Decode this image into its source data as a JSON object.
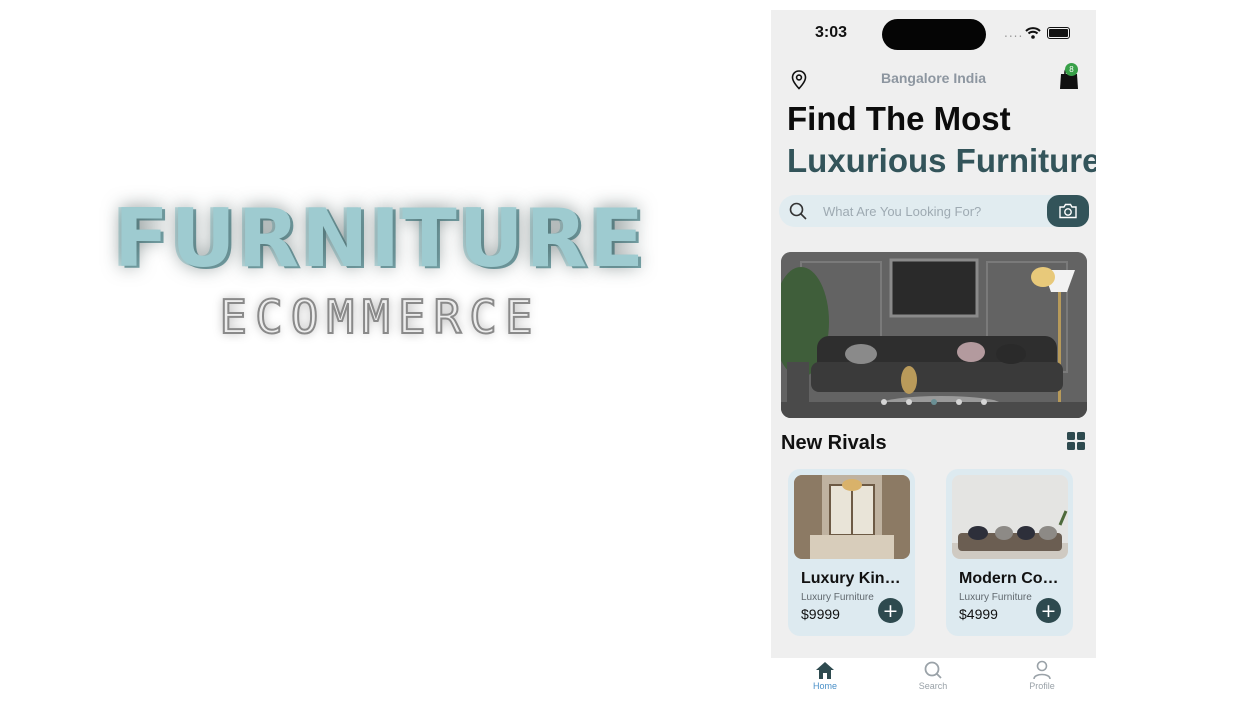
{
  "logo": {
    "title": "FURNITURE",
    "subtitle": "ECOMMERCE"
  },
  "status_bar": {
    "time": "3:03",
    "signal_dots": "...."
  },
  "header": {
    "location": "Bangalore India",
    "cart_badge": "8"
  },
  "hero": {
    "line1": "Find The Most",
    "line2": "Luxurious Furniture"
  },
  "search": {
    "placeholder": "What Are You Looking For?"
  },
  "banner": {
    "slide_count": 5,
    "active_index": 2
  },
  "section": {
    "title": "New Rivals"
  },
  "products": [
    {
      "name": "Luxury King Bed",
      "category": "Luxury Furniture",
      "price": "$9999"
    },
    {
      "name": "Modern Couch",
      "category": "Luxury Furniture",
      "price": "$4999"
    }
  ],
  "tabs": [
    {
      "label": "Home",
      "active": true
    },
    {
      "label": "Search",
      "active": false
    },
    {
      "label": "Profile",
      "active": false
    }
  ],
  "colors": {
    "accent": "#33545a",
    "active_tab": "#4a90c8",
    "badge": "#38a048",
    "logo": "#9ecbd0"
  }
}
